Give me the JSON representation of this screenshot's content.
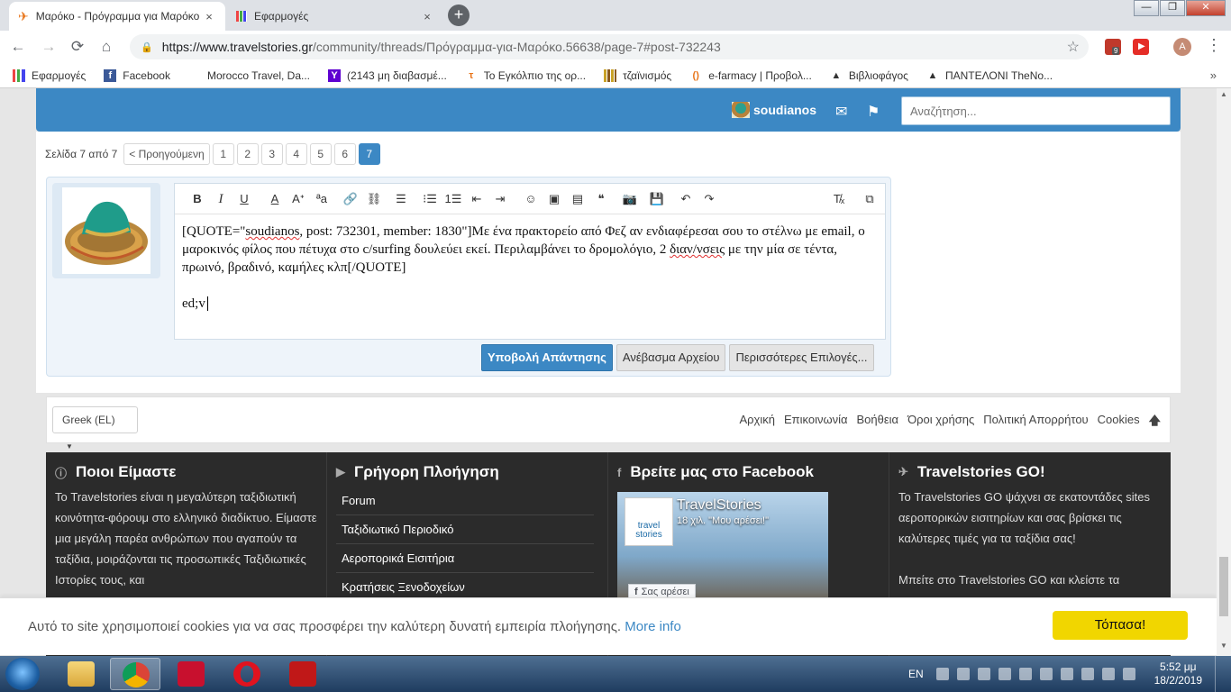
{
  "browser": {
    "tabs": [
      {
        "title": "Μαρόκο - Πρόγραμμα για Μαρόκο",
        "close": "×"
      },
      {
        "title": "Εφαρμογές",
        "close": "×"
      }
    ],
    "new_tab": "+",
    "window_controls": {
      "minimize": "—",
      "maximize": "❐",
      "close": "✕"
    },
    "nav": {
      "back": "←",
      "forward": "→",
      "reload": "⟳",
      "home": "⌂"
    },
    "url_host": "https://www.travelstories.gr",
    "url_path": "/community/threads/Πρόγραμμα-για-Μαρόκο.56638/page-7#post-732243",
    "extension_badge": "9",
    "avatar_letter": "A",
    "bookmarks": [
      {
        "label": "Εφαρμογές",
        "icon": "apps-grid-icon"
      },
      {
        "label": "Facebook",
        "icon": "facebook-icon"
      },
      {
        "label": "Morocco Travel, Da...",
        "icon": "page-icon"
      },
      {
        "label": "(2143 μη διαβασμέ...",
        "icon": "yahoo-icon"
      },
      {
        "label": "Το Εγκόλπιο της ορ...",
        "icon": "site-icon"
      },
      {
        "label": "τζαϊνισμός",
        "icon": "bars-icon"
      },
      {
        "label": "e-farmacy | Προβολ...",
        "icon": "e-icon"
      },
      {
        "label": "Βιβλιοφάγος",
        "icon": "triangle-icon"
      },
      {
        "label": "ΠΑΝΤΕΛΟΝΙ TheNo...",
        "icon": "triangle-icon"
      }
    ],
    "bookmarks_more": "»"
  },
  "header": {
    "username": "soudianos",
    "search_placeholder": "Αναζήτηση..."
  },
  "pager": {
    "label": "Σελίδα 7 από 7",
    "prev": "< Προηγούμενη",
    "pages": [
      "1",
      "2",
      "3",
      "4",
      "5",
      "6",
      "7"
    ],
    "current": "7"
  },
  "editor": {
    "line1_pre": "[QUOTE=\"",
    "quote_user": "soudianos",
    "line1_post": ", post: 732301, member: 1830\"]Με ένα πρακτορείο από Φεζ αν ενδιαφέρεσαι σου το στέλνω με email, ο μαροκινός φίλος που πέτυχα στο c/surfing δουλεύει εκεί. Περιλαμβάνει το δρομολόγιο, 2 ",
    "spell1": "διαν/νσεις",
    "line1_end": " με την μία σε τέντα, πρωινό, βραδινό, καμήλες κλπ[/QUOTE]",
    "line2": "ed;v"
  },
  "buttons": {
    "submit": "Υποβολή Απάντησης",
    "upload": "Ανέβασμα Αρχείου",
    "more": "Περισσότερες Επιλογές..."
  },
  "footer_bar": {
    "language": "Greek (EL)",
    "links": [
      "Αρχική",
      "Επικοινωνία",
      "Βοήθεια",
      "Όροι χρήσης",
      "Πολιτική Απορρήτου",
      "Cookies"
    ]
  },
  "footer": {
    "about": {
      "title": "Ποιοι Είμαστε",
      "text": "Το Travelstories είναι η μεγαλύτερη ταξιδιωτική κοινότητα-φόρουμ στο ελληνικό διαδίκτυο. Είμαστε μια μεγάλη παρέα ανθρώπων που αγαπούν τα ταξίδια, μοιράζονται τις προσωπικές Ταξιδιωτικές Ιστορίες τους, και"
    },
    "quicknav": {
      "title": "Γρήγορη Πλοήγηση",
      "items": [
        "Forum",
        "Ταξιδιωτικό Περιοδικό",
        "Αεροπορικά Εισιτήρια",
        "Κρατήσεις Ξενοδοχείων"
      ]
    },
    "facebook": {
      "title": "Βρείτε μας στο Facebook",
      "page_name": "TravelStories",
      "likes": "18 χιλ. \"Μου αρέσει!\"",
      "logo_text": "travel stories",
      "like_button": "Σας αρέσει"
    },
    "go": {
      "title": "Travelstories GO!",
      "text1": "Το Travelstories GO ψάχνει σε εκατοντάδες sites αεροπορικών εισιτηρίων και σας βρίσκει τις καλύτερες τιμές για τα ταξίδια σας!",
      "text2": "Μπείτε στο Travelstories GO και κλείστε τα"
    }
  },
  "cookie": {
    "text": "Αυτό το site χρησιμοποιεί cookies για να σας προσφέρει την καλύτερη δυνατή εμπειρία πλοήγησης.",
    "link": "More info",
    "button": "Τόπασα!"
  },
  "taskbar": {
    "lang": "EN",
    "time": "5:52 μμ",
    "date": "18/2/2019"
  }
}
